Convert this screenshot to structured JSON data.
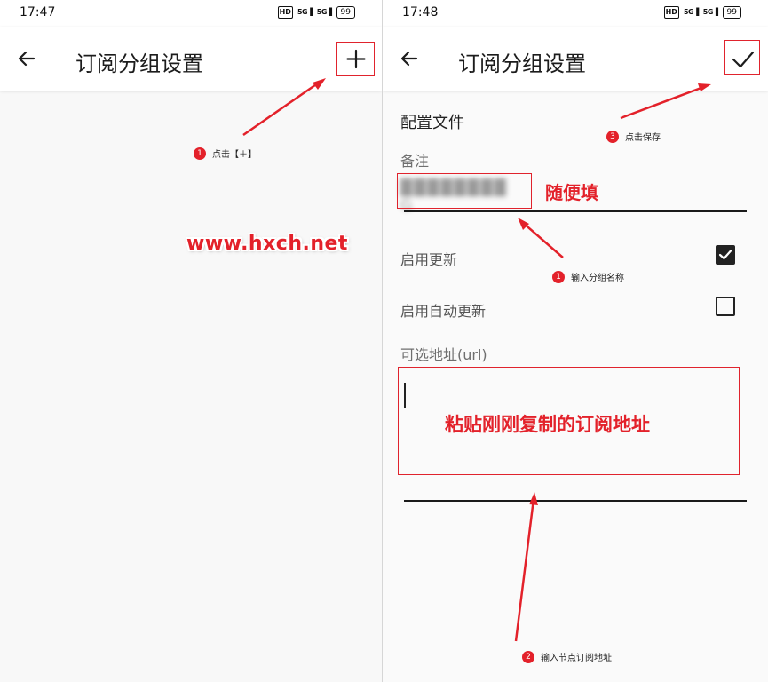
{
  "left_screen": {
    "status_time": "17:47",
    "status_icons": [
      "hd-icon",
      "5g-signal-icon",
      "5g-signal-icon",
      "battery-icon"
    ],
    "hd_label": "HD",
    "signal_label_1": "5G",
    "signal_label_2": "5G",
    "battery_level": "99",
    "title": "订阅分组设置",
    "action_icon": "plus-icon",
    "annotation_number": "1",
    "annotation_text": "点击【＋】",
    "watermark": "www.hxch.net"
  },
  "right_screen": {
    "status_time": "17:48",
    "status_icons": [
      "hd-icon",
      "5g-signal-icon",
      "5g-signal-icon",
      "battery-icon"
    ],
    "hd_label": "HD",
    "signal_label_1": "5G",
    "signal_label_2": "5G",
    "battery_level": "99",
    "title": "订阅分组设置",
    "action_icon": "check-icon",
    "section_title": "配置文件",
    "remark_label": "备注",
    "remark_value": "G",
    "remark_note": "随便填",
    "enable_update_label": "启用更新",
    "enable_update_checked": true,
    "enable_auto_update_label": "启用自动更新",
    "enable_auto_update_checked": false,
    "url_label": "可选地址(url)",
    "url_note": "粘贴刚刚复制的订阅地址",
    "annotations": [
      {
        "number": "3",
        "text": "点击保存"
      },
      {
        "number": "1",
        "text": "输入分组名称"
      },
      {
        "number": "2",
        "text": "输入节点订阅地址"
      }
    ]
  },
  "colors": {
    "annotation_red": "#e3212a",
    "text_dark": "#1c1c1c",
    "label_gray": "#6f6f6f"
  }
}
